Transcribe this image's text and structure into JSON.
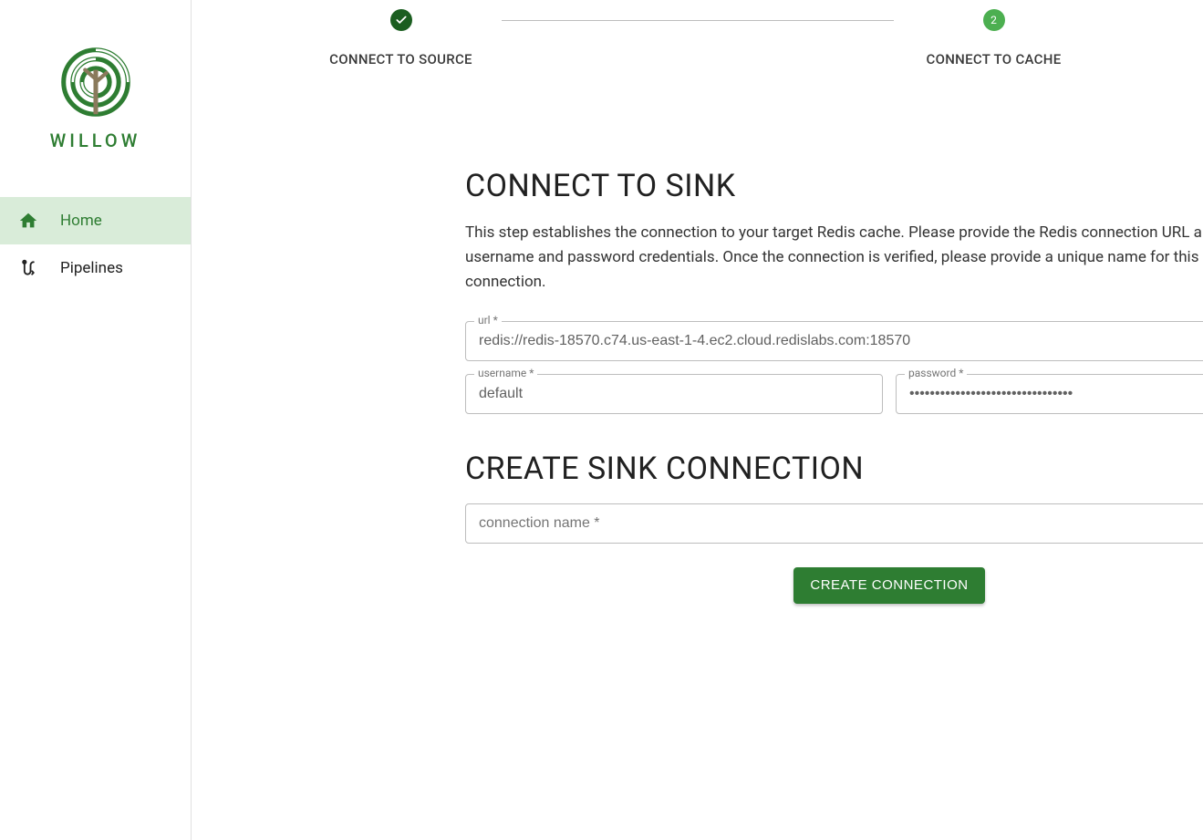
{
  "brand": {
    "name": "WILLOW"
  },
  "sidebar": {
    "items": [
      {
        "label": "Home",
        "active": true
      },
      {
        "label": "Pipelines",
        "active": false
      }
    ]
  },
  "stepper": {
    "steps": [
      {
        "label": "CONNECT TO SOURCE",
        "state": "done"
      },
      {
        "label": "CONNECT TO CACHE",
        "state": "current",
        "number": "2"
      }
    ]
  },
  "connectSink": {
    "title": "CONNECT TO SINK",
    "description": "This step establishes the connection to your target Redis cache. Please provide the Redis connection URL along with the username and password credentials. Once the connection is verified, please provide a unique name for this sink connection.",
    "fields": {
      "url": {
        "label": "url *",
        "value": "redis://redis-18570.c74.us-east-1-4.ec2.cloud.redislabs.com:18570"
      },
      "username": {
        "label": "username *",
        "value": "default"
      },
      "password": {
        "label": "password *",
        "value": "••••••••••••••••••••••••••••••••"
      }
    }
  },
  "createConnection": {
    "title": "CREATE SINK CONNECTION",
    "fields": {
      "name": {
        "placeholder": "connection name *",
        "value": ""
      }
    },
    "button": "CREATE CONNECTION"
  }
}
